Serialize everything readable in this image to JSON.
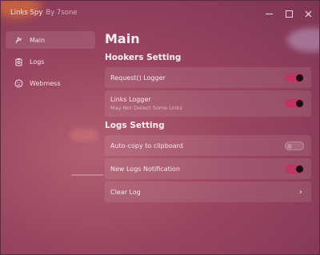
{
  "window": {
    "app_name": "Links Spy",
    "author": "By 7sone"
  },
  "sidebar": {
    "items": [
      {
        "label": "Main",
        "icon": "ghost-icon"
      },
      {
        "label": "Logs",
        "icon": "clipboard-icon"
      },
      {
        "label": "Webmess",
        "icon": "sad-face-icon"
      }
    ]
  },
  "main": {
    "title": "Main",
    "sections": [
      {
        "title": "Hookers Setting",
        "items": [
          {
            "label": "Request() Logger",
            "control": "toggle",
            "state": "on"
          },
          {
            "label": "Links Logger",
            "sub": "May Not Detect Some Links",
            "control": "toggle",
            "state": "on"
          }
        ]
      },
      {
        "title": "Logs Setting",
        "items": [
          {
            "label": "Auto-copy to clipboard",
            "control": "toggle",
            "state": "off"
          },
          {
            "label": "New Logs Notification",
            "control": "toggle",
            "state": "on"
          },
          {
            "label": "Clear Log",
            "control": "chevron"
          }
        ]
      }
    ]
  },
  "colors": {
    "accent": "#c03560",
    "window_bg": "#9a4560"
  }
}
